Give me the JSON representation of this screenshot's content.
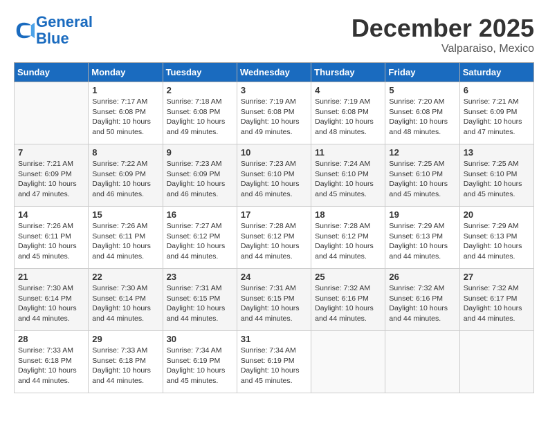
{
  "header": {
    "logo_line1": "General",
    "logo_line2": "Blue",
    "month": "December 2025",
    "location": "Valparaiso, Mexico"
  },
  "weekdays": [
    "Sunday",
    "Monday",
    "Tuesday",
    "Wednesday",
    "Thursday",
    "Friday",
    "Saturday"
  ],
  "weeks": [
    [
      {
        "day": "",
        "info": ""
      },
      {
        "day": "1",
        "info": "Sunrise: 7:17 AM\nSunset: 6:08 PM\nDaylight: 10 hours\nand 50 minutes."
      },
      {
        "day": "2",
        "info": "Sunrise: 7:18 AM\nSunset: 6:08 PM\nDaylight: 10 hours\nand 49 minutes."
      },
      {
        "day": "3",
        "info": "Sunrise: 7:19 AM\nSunset: 6:08 PM\nDaylight: 10 hours\nand 49 minutes."
      },
      {
        "day": "4",
        "info": "Sunrise: 7:19 AM\nSunset: 6:08 PM\nDaylight: 10 hours\nand 48 minutes."
      },
      {
        "day": "5",
        "info": "Sunrise: 7:20 AM\nSunset: 6:08 PM\nDaylight: 10 hours\nand 48 minutes."
      },
      {
        "day": "6",
        "info": "Sunrise: 7:21 AM\nSunset: 6:09 PM\nDaylight: 10 hours\nand 47 minutes."
      }
    ],
    [
      {
        "day": "7",
        "info": "Sunrise: 7:21 AM\nSunset: 6:09 PM\nDaylight: 10 hours\nand 47 minutes."
      },
      {
        "day": "8",
        "info": "Sunrise: 7:22 AM\nSunset: 6:09 PM\nDaylight: 10 hours\nand 46 minutes."
      },
      {
        "day": "9",
        "info": "Sunrise: 7:23 AM\nSunset: 6:09 PM\nDaylight: 10 hours\nand 46 minutes."
      },
      {
        "day": "10",
        "info": "Sunrise: 7:23 AM\nSunset: 6:10 PM\nDaylight: 10 hours\nand 46 minutes."
      },
      {
        "day": "11",
        "info": "Sunrise: 7:24 AM\nSunset: 6:10 PM\nDaylight: 10 hours\nand 45 minutes."
      },
      {
        "day": "12",
        "info": "Sunrise: 7:25 AM\nSunset: 6:10 PM\nDaylight: 10 hours\nand 45 minutes."
      },
      {
        "day": "13",
        "info": "Sunrise: 7:25 AM\nSunset: 6:10 PM\nDaylight: 10 hours\nand 45 minutes."
      }
    ],
    [
      {
        "day": "14",
        "info": "Sunrise: 7:26 AM\nSunset: 6:11 PM\nDaylight: 10 hours\nand 45 minutes."
      },
      {
        "day": "15",
        "info": "Sunrise: 7:26 AM\nSunset: 6:11 PM\nDaylight: 10 hours\nand 44 minutes."
      },
      {
        "day": "16",
        "info": "Sunrise: 7:27 AM\nSunset: 6:12 PM\nDaylight: 10 hours\nand 44 minutes."
      },
      {
        "day": "17",
        "info": "Sunrise: 7:28 AM\nSunset: 6:12 PM\nDaylight: 10 hours\nand 44 minutes."
      },
      {
        "day": "18",
        "info": "Sunrise: 7:28 AM\nSunset: 6:12 PM\nDaylight: 10 hours\nand 44 minutes."
      },
      {
        "day": "19",
        "info": "Sunrise: 7:29 AM\nSunset: 6:13 PM\nDaylight: 10 hours\nand 44 minutes."
      },
      {
        "day": "20",
        "info": "Sunrise: 7:29 AM\nSunset: 6:13 PM\nDaylight: 10 hours\nand 44 minutes."
      }
    ],
    [
      {
        "day": "21",
        "info": "Sunrise: 7:30 AM\nSunset: 6:14 PM\nDaylight: 10 hours\nand 44 minutes."
      },
      {
        "day": "22",
        "info": "Sunrise: 7:30 AM\nSunset: 6:14 PM\nDaylight: 10 hours\nand 44 minutes."
      },
      {
        "day": "23",
        "info": "Sunrise: 7:31 AM\nSunset: 6:15 PM\nDaylight: 10 hours\nand 44 minutes."
      },
      {
        "day": "24",
        "info": "Sunrise: 7:31 AM\nSunset: 6:15 PM\nDaylight: 10 hours\nand 44 minutes."
      },
      {
        "day": "25",
        "info": "Sunrise: 7:32 AM\nSunset: 6:16 PM\nDaylight: 10 hours\nand 44 minutes."
      },
      {
        "day": "26",
        "info": "Sunrise: 7:32 AM\nSunset: 6:16 PM\nDaylight: 10 hours\nand 44 minutes."
      },
      {
        "day": "27",
        "info": "Sunrise: 7:32 AM\nSunset: 6:17 PM\nDaylight: 10 hours\nand 44 minutes."
      }
    ],
    [
      {
        "day": "28",
        "info": "Sunrise: 7:33 AM\nSunset: 6:18 PM\nDaylight: 10 hours\nand 44 minutes."
      },
      {
        "day": "29",
        "info": "Sunrise: 7:33 AM\nSunset: 6:18 PM\nDaylight: 10 hours\nand 44 minutes."
      },
      {
        "day": "30",
        "info": "Sunrise: 7:34 AM\nSunset: 6:19 PM\nDaylight: 10 hours\nand 45 minutes."
      },
      {
        "day": "31",
        "info": "Sunrise: 7:34 AM\nSunset: 6:19 PM\nDaylight: 10 hours\nand 45 minutes."
      },
      {
        "day": "",
        "info": ""
      },
      {
        "day": "",
        "info": ""
      },
      {
        "day": "",
        "info": ""
      }
    ]
  ]
}
